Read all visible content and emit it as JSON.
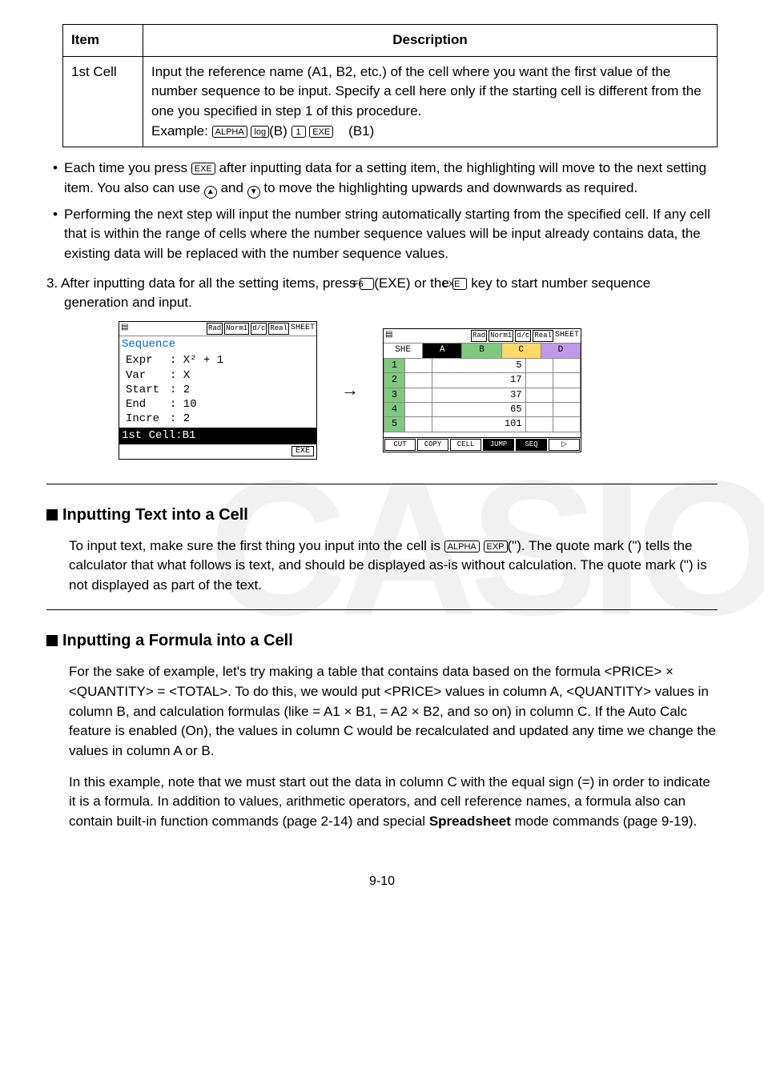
{
  "table": {
    "h_item": "Item",
    "h_desc": "Description",
    "r1_item": "1st Cell",
    "r1_desc_l1": "Input the reference name (A1, B2, etc.) of the cell where you want the first value of the number sequence to be input. Specify a cell here only if the starting cell is different from the one you specified in step 1 of this procedure.",
    "r1_ex_label": "Example:",
    "r1_ex_keys": [
      "ALPHA",
      "log",
      "(B)",
      "1",
      "EXE"
    ],
    "r1_ex_result": "(B1)"
  },
  "bullet1_a": "Each time you press ",
  "bullet1_key": "EXE",
  "bullet1_b": " after inputting data for a setting item, the highlighting will move to the next setting item. You also can use ",
  "bullet1_c": " and ",
  "bullet1_d": " to move the highlighting upwards and downwards as required.",
  "bullet2": "Performing the next step will input the number string automatically starting from the specified cell. If any cell that is within the range of cells where the number sequence values will be input already contains data, the existing data will be replaced with the number sequence values.",
  "step3_a": "3. After inputting data for all the setting items, press ",
  "step3_k1": "F6",
  "step3_mid": "(EXE) or the ",
  "step3_k2": "EXE",
  "step3_b": " key to start number sequence generation and input.",
  "calc1": {
    "status_tags": [
      "Rad",
      "Norm1",
      "d/c",
      "Real"
    ],
    "status_right": "SHEET",
    "title": "Sequence",
    "rows": [
      [
        "Expr",
        ": X² + 1"
      ],
      [
        "Var",
        ": X"
      ],
      [
        "Start",
        ": 2"
      ],
      [
        "End",
        ": 10"
      ],
      [
        "Incre",
        ": 2"
      ]
    ],
    "highlight": "1st Cell:B1",
    "btn": "EXE"
  },
  "calc2": {
    "status_tags": [
      "Rad",
      "Norm1",
      "d/c",
      "Real"
    ],
    "status_right": "SHEET",
    "tabs": [
      "SHE",
      "A",
      "B",
      "C",
      "D"
    ],
    "rows": [
      [
        "1",
        "",
        "5",
        "",
        ""
      ],
      [
        "2",
        "",
        "17",
        "",
        ""
      ],
      [
        "3",
        "",
        "37",
        "",
        ""
      ],
      [
        "4",
        "",
        "65",
        "",
        ""
      ],
      [
        "5",
        "",
        "101",
        "",
        ""
      ]
    ],
    "btns": [
      "CUT",
      "COPY",
      "CELL",
      "JUMP",
      "SEQ",
      "▷"
    ]
  },
  "sec1_title": "Inputting Text into a Cell",
  "sec1_body_a": "To input text, make sure the first thing you input into the cell is ",
  "sec1_k1": "ALPHA",
  "sec1_k2": "EXP",
  "sec1_body_b": "(\"). The quote mark (\") tells the calculator that what follows is text, and should be displayed as-is without calculation. The quote mark (\") is not displayed as part of the text.",
  "sec2_title": "Inputting a Formula into a Cell",
  "sec2_p1": "For the sake of example, let's try making a table that contains data based on the formula <PRICE> × <QUANTITY> = <TOTAL>. To do this, we would put <PRICE> values in column A, <QUANTITY> values in column B, and calculation formulas (like = A1 × B1, = A2 × B2, and so on) in column C. If the Auto Calc feature is enabled (On), the values in column C would be recalculated and updated any time we change the values in column A or B.",
  "sec2_p2_a": "In this example, note that we must start out the data in column C with the equal sign (=) in order to indicate it is a formula. In addition to values, arithmetic operators, and cell reference names, a formula also can contain built-in function commands (page 2-14) and special ",
  "sec2_p2_bold": "Spreadsheet",
  "sec2_p2_b": " mode commands (page 9-19).",
  "footer": "9-10"
}
